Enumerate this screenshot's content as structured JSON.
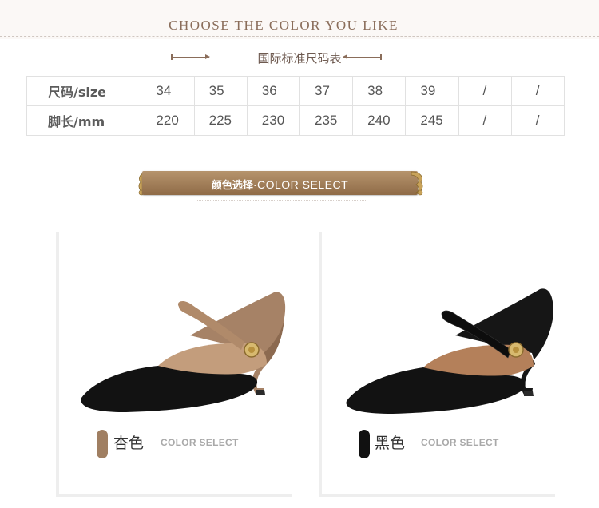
{
  "header": {
    "title": "CHOOSE THE COLOR YOU LIKE",
    "subtitle": "国际标准尺码表"
  },
  "size_table": {
    "rows": [
      {
        "label": "尺码/size",
        "values": [
          "34",
          "35",
          "36",
          "37",
          "38",
          "39",
          "/",
          "/"
        ]
      },
      {
        "label": "脚长/mm",
        "values": [
          "220",
          "225",
          "230",
          "235",
          "240",
          "245",
          "/",
          "/"
        ]
      }
    ]
  },
  "banner": {
    "cn": "颜色选择",
    "en": "·COLOR SELECT"
  },
  "colors": [
    {
      "name": "杏色",
      "caption": "COLOR SELECT",
      "swatch": "#a07f62"
    },
    {
      "name": "黑色",
      "caption": "COLOR SELECT",
      "swatch": "#111111"
    }
  ],
  "theme": {
    "accent": "#8a6d5a",
    "banner_gold": "#a88762"
  }
}
